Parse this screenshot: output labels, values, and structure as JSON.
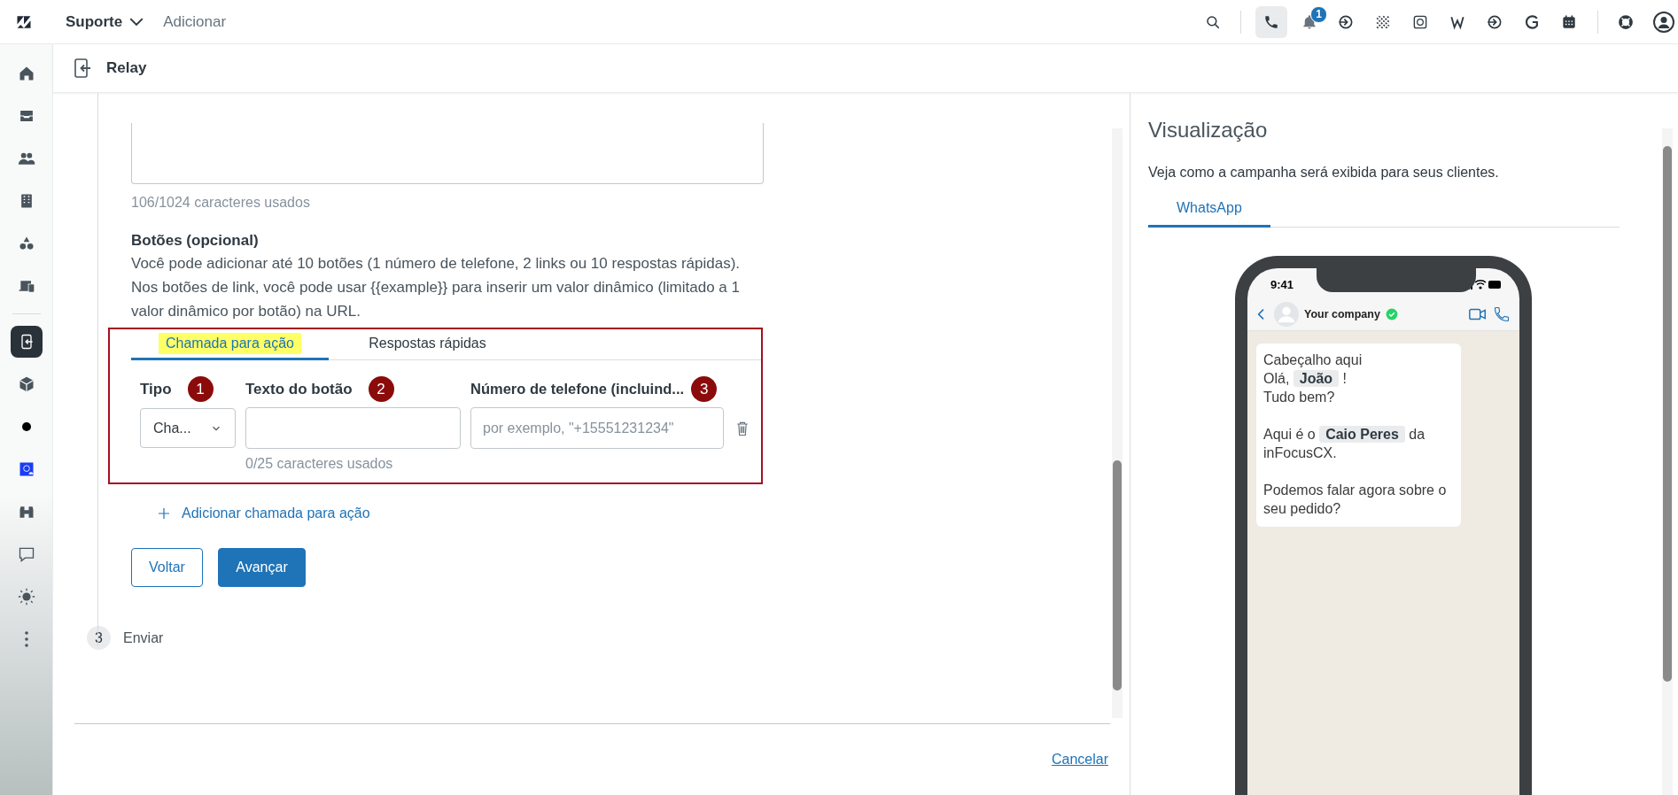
{
  "topbar": {
    "product": "Suporte",
    "add_link": "Adicionar",
    "phone_active": true,
    "notification_count": "1"
  },
  "sidebar": {
    "items": [
      {
        "kind": "home",
        "selected": false
      },
      {
        "kind": "inbox",
        "selected": false
      },
      {
        "kind": "people",
        "selected": false
      },
      {
        "kind": "building",
        "selected": false
      },
      {
        "kind": "shapes",
        "selected": false
      },
      {
        "kind": "devices",
        "selected": false
      },
      {
        "kind": "separator"
      },
      {
        "kind": "relay",
        "selected": true
      },
      {
        "kind": "cube",
        "selected": false
      },
      {
        "kind": "dot",
        "selected": false
      },
      {
        "kind": "app",
        "selected": false
      },
      {
        "kind": "binoculars",
        "selected": false
      },
      {
        "kind": "chat",
        "selected": false
      },
      {
        "kind": "sun",
        "selected": false
      },
      {
        "kind": "more",
        "selected": false
      }
    ]
  },
  "app_header": {
    "title": "Relay"
  },
  "form": {
    "body_counter": "106/1024 caracteres usados",
    "buttons_title": "Botões (opcional)",
    "buttons_help": "Você pode adicionar até 10 botões (1 número de telefone, 2 links ou 10 respostas rápidas). Nos botões de link, você pode usar {{example}} para inserir um valor dinâmico (limitado a 1 valor dinâmico por botão) na URL.",
    "tabs": [
      {
        "label": "Chamada para ação",
        "selected": true,
        "highlighted": true
      },
      {
        "label": "Respostas rápidas",
        "selected": false,
        "highlighted": false
      }
    ],
    "columns": [
      {
        "label": "Tipo",
        "marker": "1"
      },
      {
        "label": "Texto do botão",
        "marker": "2"
      },
      {
        "label": "Número de telefone (incluind...",
        "marker": "3"
      }
    ],
    "row": {
      "type_value": "Cha...",
      "phone_placeholder": "por exemplo, \"+15551231234\"",
      "text_counter": "0/25 caracteres usados"
    },
    "add_action": "Adicionar chamada para ação",
    "back_button": "Voltar",
    "next_button": "Avançar",
    "step": {
      "number": "3",
      "label": "Enviar"
    },
    "cancel": "Cancelar"
  },
  "preview": {
    "title": "Visualização",
    "description": "Veja como a campanha será exibida para seus clientes.",
    "tabs": [
      {
        "label": "WhatsApp",
        "selected": true
      }
    ],
    "phone": {
      "time": "9:41",
      "contact": "Your company",
      "message": [
        {
          "kind": "text",
          "text": "Cabeçalho aqui\nOlá, "
        },
        {
          "kind": "variable",
          "text": "João"
        },
        {
          "kind": "text",
          "text": " !\nTudo bem?\n\nAqui é o "
        },
        {
          "kind": "variable",
          "text": "Caio Peres"
        },
        {
          "kind": "text",
          "text": " da inFocusCX.\n\nPodemos falar agora sobre o seu pedido?"
        }
      ]
    }
  }
}
